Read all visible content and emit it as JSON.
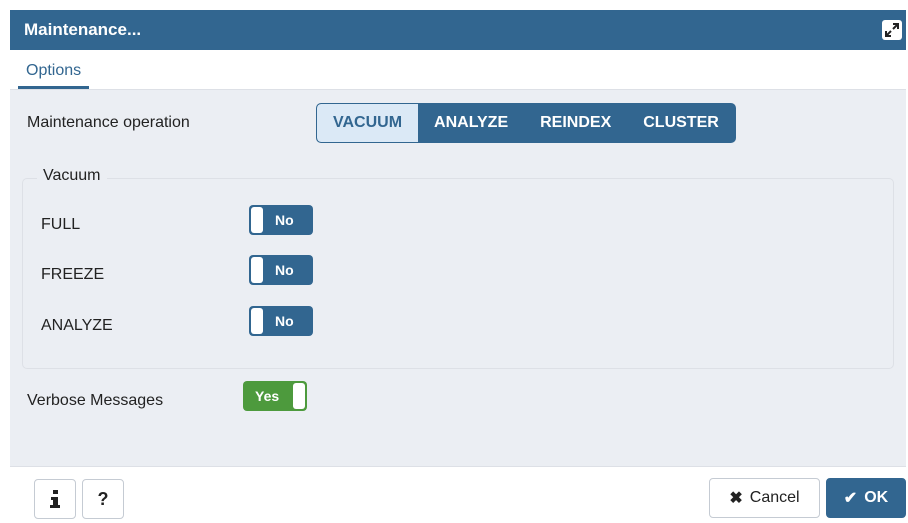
{
  "dialog": {
    "title": "Maintenance...",
    "expand_icon": "expand-icon"
  },
  "tabs": [
    {
      "label": "Options",
      "active": true
    }
  ],
  "maintenance": {
    "label": "Maintenance operation",
    "operations": [
      {
        "label": "VACUUM",
        "selected": true
      },
      {
        "label": "ANALYZE",
        "selected": false
      },
      {
        "label": "REINDEX",
        "selected": false
      },
      {
        "label": "CLUSTER",
        "selected": false
      }
    ]
  },
  "vacuum": {
    "legend": "Vacuum",
    "options": [
      {
        "label": "FULL",
        "value": "No",
        "on": false
      },
      {
        "label": "FREEZE",
        "value": "No",
        "on": false
      },
      {
        "label": "ANALYZE",
        "value": "No",
        "on": false
      }
    ]
  },
  "verbose": {
    "label": "Verbose Messages",
    "value": "Yes",
    "on": true
  },
  "footer": {
    "info_icon": "info-icon",
    "help_icon": "help-icon",
    "cancel_label": "Cancel",
    "cancel_icon": "close-icon",
    "ok_label": "OK",
    "ok_icon": "check-icon"
  },
  "colors": {
    "primary": "#326690",
    "success": "#4d9a3d",
    "panel_bg": "#ebeef3",
    "selected_segment_bg": "#dbe9f6"
  }
}
